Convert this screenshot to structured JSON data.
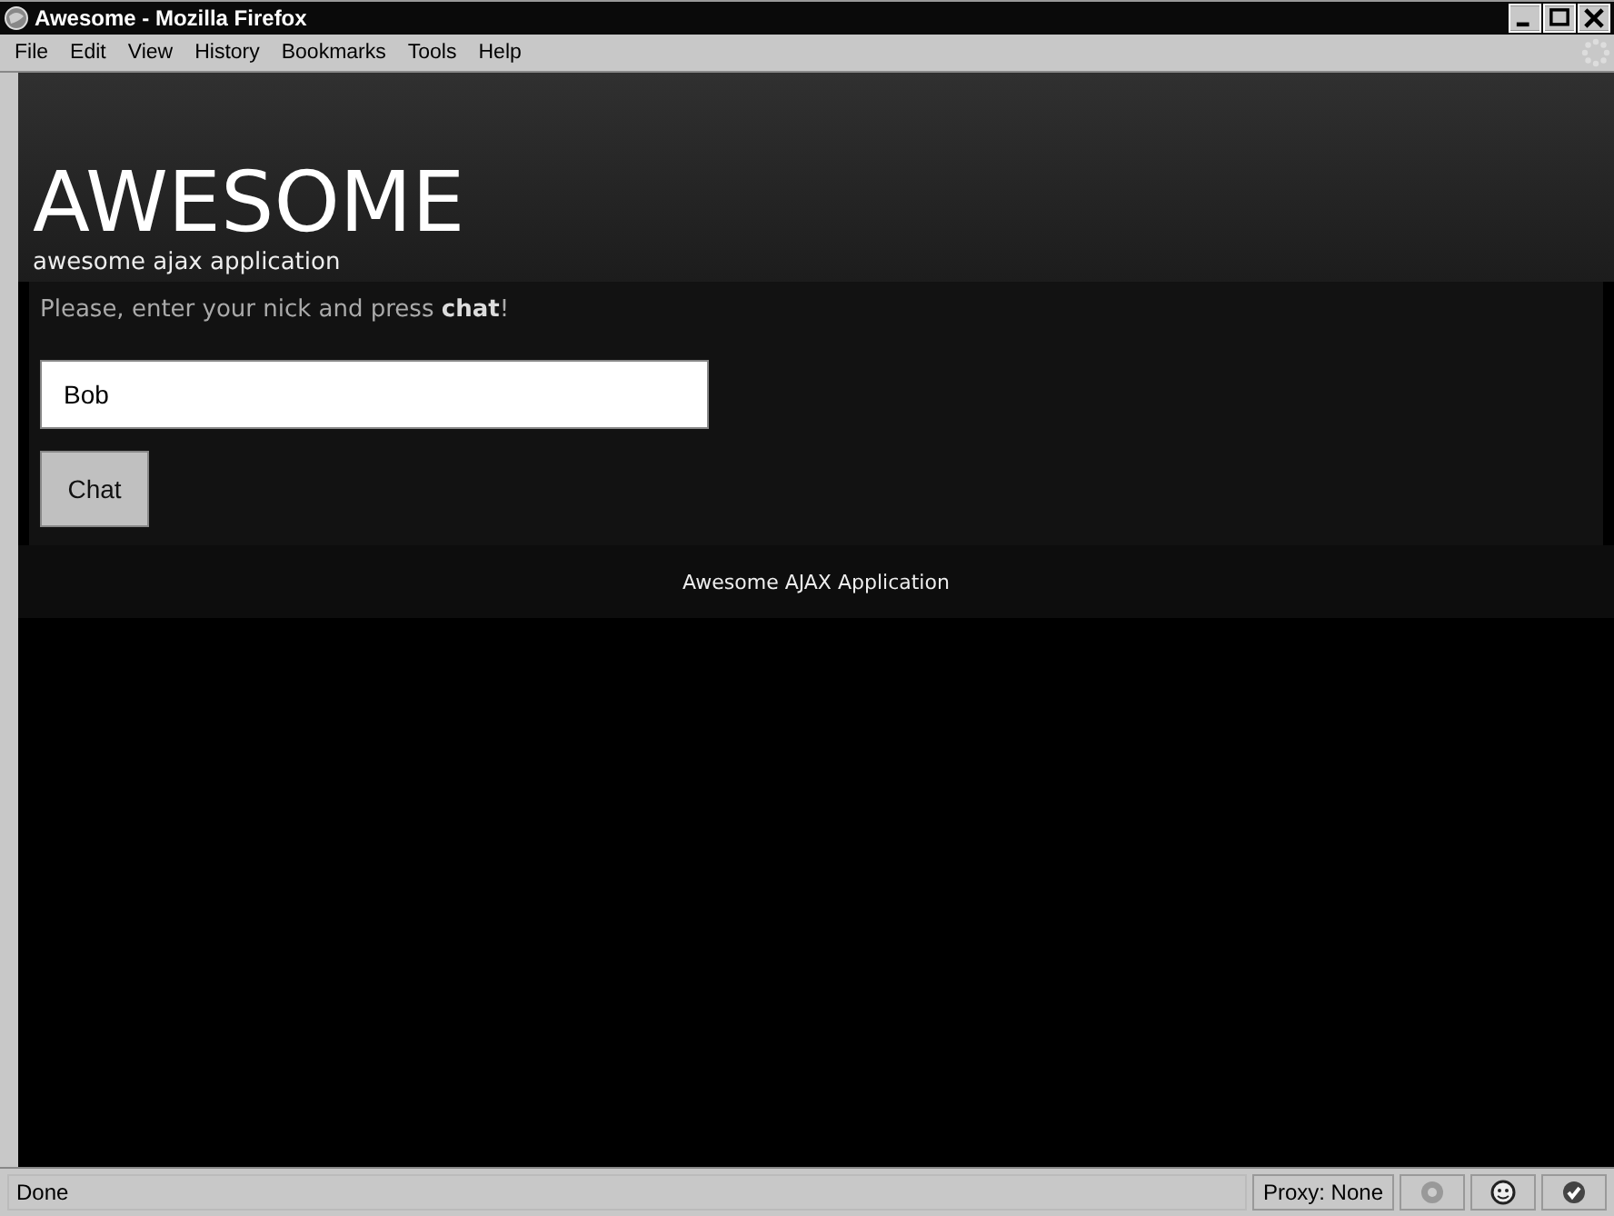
{
  "window": {
    "title": "Awesome - Mozilla Firefox"
  },
  "menu": [
    "File",
    "Edit",
    "View",
    "History",
    "Bookmarks",
    "Tools",
    "Help"
  ],
  "header": {
    "logo": "AWESOME",
    "tagline": "awesome ajax application"
  },
  "form": {
    "prompt": "Please, enter your nick and press **chat**!",
    "nick_value": "Bob",
    "button": "Chat"
  },
  "footer": "Awesome AJAX Application",
  "status_bar": {
    "status": "Done",
    "proxy": "Proxy: None"
  }
}
